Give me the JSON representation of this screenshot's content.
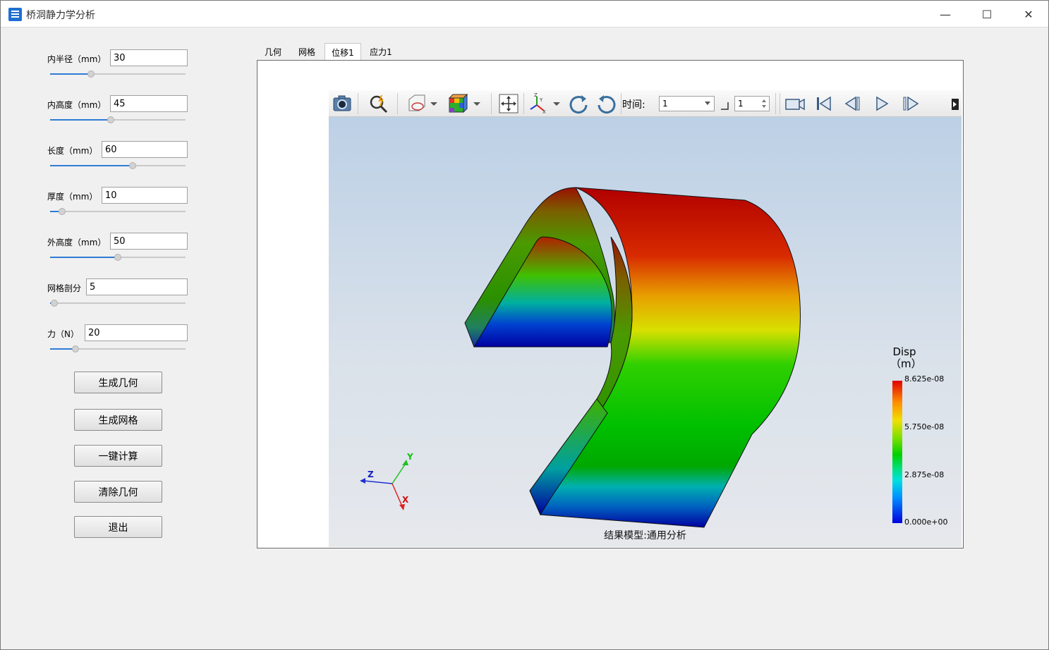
{
  "window": {
    "title": "桥洞静力学分析",
    "minimize_glyph": "—",
    "maximize_glyph": "☐",
    "close_glyph": "✕"
  },
  "params": [
    {
      "label": "内半径（mm）",
      "value": "30",
      "slider_fraction": 0.3
    },
    {
      "label": "内高度（mm）",
      "value": "45",
      "slider_fraction": 0.45
    },
    {
      "label": "长度（mm）",
      "value": "60",
      "slider_fraction": 0.61
    },
    {
      "label": "厚度（mm）",
      "value": "10",
      "slider_fraction": 0.09
    },
    {
      "label": "外高度（mm）",
      "value": "50",
      "slider_fraction": 0.5
    },
    {
      "label": "网格剖分",
      "value": "5",
      "slider_fraction": 0.03
    },
    {
      "label": "力（N）",
      "value": "20",
      "slider_fraction": 0.19
    }
  ],
  "buttons": {
    "generate_geometry": "生成几何",
    "generate_mesh": "生成网格",
    "compute": "一键计算",
    "clear_geometry": "清除几何",
    "exit": "退出"
  },
  "tabs": [
    {
      "label": "几何",
      "active": false
    },
    {
      "label": "网格",
      "active": false
    },
    {
      "label": "位移1",
      "active": true
    },
    {
      "label": "应力1",
      "active": false
    }
  ],
  "toolbar": {
    "time_label": "时间:",
    "time_value": "1",
    "step_value": "1"
  },
  "viewport": {
    "caption": "结果模型:通用分析",
    "axes": {
      "x": "X",
      "y": "Y",
      "z": "Z"
    }
  },
  "legend": {
    "title": "Disp",
    "unit": "（m）",
    "ticks": [
      "8.625e-08",
      "5.750e-08",
      "2.875e-08",
      "0.000e+00"
    ]
  },
  "colors": {
    "accent": "#2f7cd6",
    "max": "#e00000",
    "min": "#0000e0"
  }
}
